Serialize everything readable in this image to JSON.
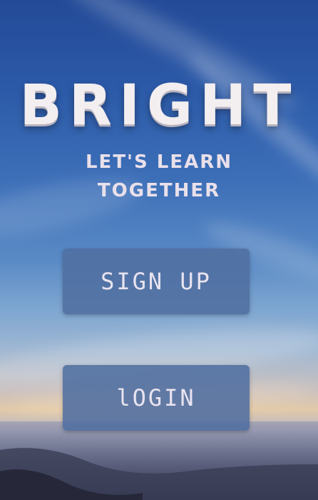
{
  "app": {
    "logo_text": "BRIGHT",
    "tagline_line1": "LET'S LEARN",
    "tagline_line2": "TOGETHER"
  },
  "actions": {
    "signup_label": "SIGN UP",
    "login_label": "lOGIN"
  },
  "colors": {
    "button_bg": "#506ea0",
    "text_light": "#f3eef0",
    "sky_top": "#234a97",
    "horizon": "#e2c9a8"
  }
}
